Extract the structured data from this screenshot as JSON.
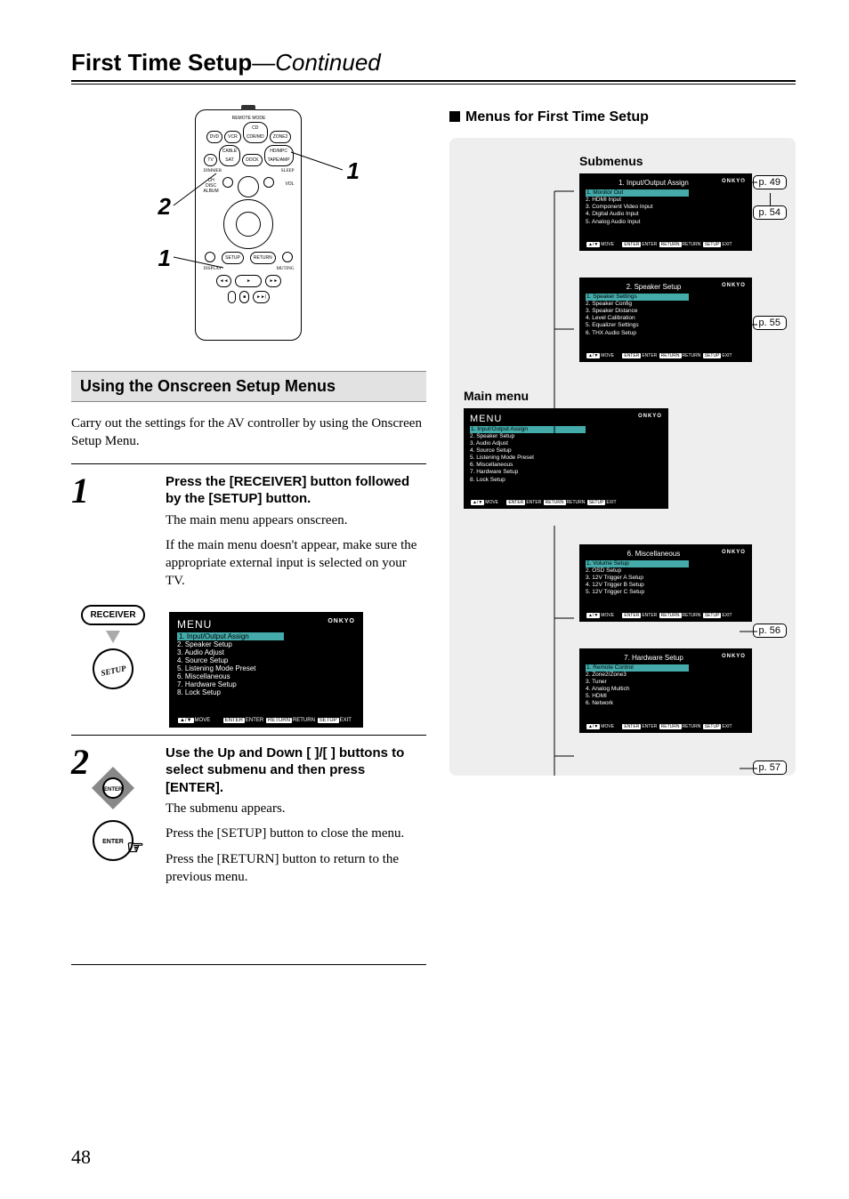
{
  "header": {
    "title_bold": "First Time Setup",
    "title_sep": "—",
    "title_ital": "Continued"
  },
  "remote": {
    "callout_left_top": "2",
    "callout_left_bottom": "1",
    "callout_right": "1"
  },
  "section_bar": "Using the Onscreen Setup Menus",
  "intro_text": "Carry out the settings for the AV controller by using the Onscreen Setup Menu.",
  "buttons": {
    "receiver": "RECEIVER",
    "setup_label": "SETUP",
    "enter_label": "ENTER"
  },
  "step1": {
    "num": "1",
    "title": "Press the [RECEIVER] button followed by the [SETUP] button.",
    "line1": "The main menu appears onscreen.",
    "line2": "If the main menu doesn't appear, make sure the appropriate external input is selected on your TV."
  },
  "step2": {
    "num": "2",
    "title": "Use the Up and Down [   ]/[   ] buttons to select submenu and then press [ENTER].",
    "line1": "The submenu appears.",
    "line2": "Press the [SETUP] button to close the menu.",
    "line3": "Press the [RETURN] button to return to the previous menu."
  },
  "osd_main": {
    "title": "MENU",
    "brand": "ONKYO",
    "items": [
      "1. Input/Output Assign",
      "2. Speaker Setup",
      "3. Audio Adjust",
      "4. Source Setup",
      "5. Listening Mode Preset",
      "6. Miscellaneous",
      "7. Hardware Setup",
      "8. Lock Setup"
    ],
    "footer": {
      "move": "MOVE",
      "enter": "ENTER",
      "return": "RETURN",
      "exit": "EXIT"
    }
  },
  "right": {
    "heading": "Menus for First Time Setup",
    "submenus_label": "Submenus",
    "main_label": "Main menu",
    "panels": {
      "io": {
        "title": "1.   Input/Output Assign",
        "items": [
          "1.   Monitor Out",
          "2.   HDMI Input",
          "3.   Component Video Input",
          "4.   Digital Audio Input",
          "5.   Analog Audio Input"
        ]
      },
      "spk": {
        "title": "2.   Speaker Setup",
        "items": [
          "1.   Speaker Settings",
          "2.   Speaker Config",
          "3.   Speaker Distance",
          "4.   Level Calibration",
          "5.   Equalizer Settings",
          "6.   THX Audio Setup"
        ]
      },
      "misc": {
        "title": "6.   Miscellaneous",
        "items": [
          "1.   Volume Setup",
          "2.   OSD Setup",
          "3.   12V Trigger A Setup",
          "4.   12V Trigger B Setup",
          "5.   12V Trigger C Setup"
        ]
      },
      "hw": {
        "title": "7.   Hardware Setup",
        "items": [
          "1.   Remote Control",
          "2.   Zone2/Zone3",
          "3.   Tuner",
          "4.   Analog Multich",
          "5.   HDMI",
          "6.   Network"
        ]
      }
    },
    "page_refs": {
      "p49": "p. 49",
      "p54": "p. 54",
      "p55": "p. 55",
      "p56": "p. 56",
      "p57": "p. 57"
    }
  },
  "page_number": "48",
  "brand": "ONKYO",
  "footer_keys": {
    "move": "MOVE",
    "enter": "ENTER",
    "return": "RETURN",
    "exit": "EXIT"
  }
}
